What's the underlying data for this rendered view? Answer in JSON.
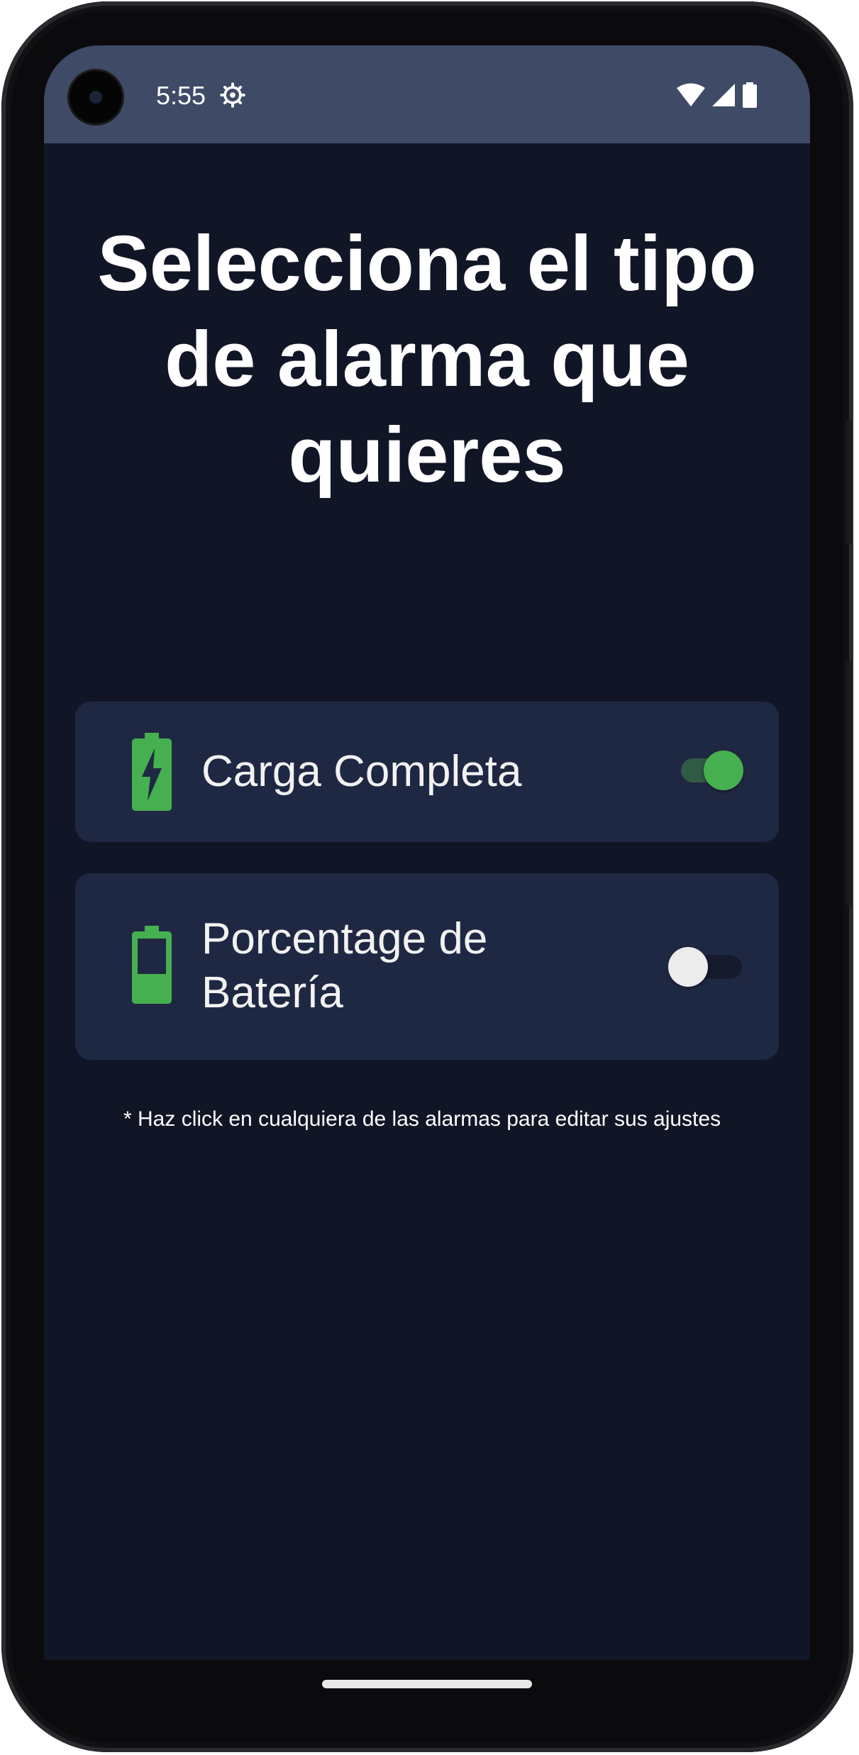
{
  "status_bar": {
    "time": "5:55",
    "icons": [
      "settings-gear-icon",
      "wifi-icon",
      "cellular-signal-icon",
      "battery-icon"
    ]
  },
  "main": {
    "title": "Selecciona el tipo de alarma que quieres",
    "alarms": [
      {
        "label": "Carga Completa",
        "icon": "battery-charging-icon",
        "enabled": true
      },
      {
        "label": "Porcentage de Batería",
        "icon": "battery-full-icon",
        "enabled": false
      }
    ],
    "hint": "* Haz click en cualquiera de las alarmas para editar sus ajustes"
  },
  "colors": {
    "background": "#111626",
    "status_bar": "#3e4a66",
    "card": "#1f2843",
    "accent_green": "#46b050"
  }
}
